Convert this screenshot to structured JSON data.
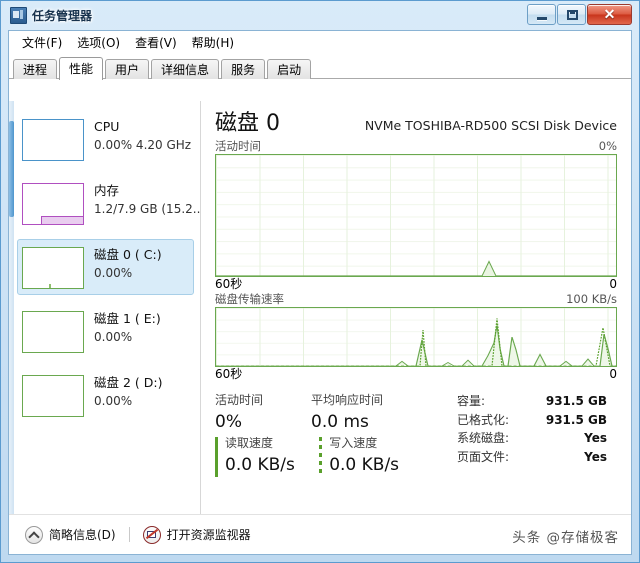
{
  "window": {
    "title": "任务管理器",
    "icon": "task-manager-icon",
    "buttons": {
      "minimize": "–",
      "maximize": "□",
      "close": "✕"
    }
  },
  "menu": [
    {
      "label": "文件(F)"
    },
    {
      "label": "选项(O)"
    },
    {
      "label": "查看(V)"
    },
    {
      "label": "帮助(H)"
    }
  ],
  "tabs": [
    {
      "label": "进程",
      "active": false
    },
    {
      "label": "性能",
      "active": true
    },
    {
      "label": "用户",
      "active": false
    },
    {
      "label": "详细信息",
      "active": false
    },
    {
      "label": "服务",
      "active": false
    },
    {
      "label": "启动",
      "active": false
    }
  ],
  "sidebar": {
    "items": [
      {
        "title": "CPU",
        "sub": "0.00%  4.20 GHz",
        "kind": "cpu",
        "selected": false
      },
      {
        "title": "内存",
        "sub": "1.2/7.9 GB (15.2...",
        "kind": "mem",
        "selected": false
      },
      {
        "title": "磁盘 0 ( C:)",
        "sub": "0.00%",
        "kind": "disk",
        "selected": true
      },
      {
        "title": "磁盘 1 ( E:)",
        "sub": "0.00%",
        "kind": "disk",
        "selected": false
      },
      {
        "title": "磁盘 2 ( D:)",
        "sub": "0.00%",
        "kind": "disk",
        "selected": false
      }
    ]
  },
  "main": {
    "title": "磁盘 0",
    "device": "NVMe TOSHIBA-RD500 SCSI Disk Device",
    "activity": {
      "label": "活动时间",
      "max": "0%",
      "x_left": "60秒",
      "x_right": "0"
    },
    "transfer": {
      "label": "磁盘传输速率",
      "max": "100 KB/s",
      "x_left": "60秒",
      "x_right": "0"
    },
    "stats_left": [
      {
        "label": "活动时间",
        "value": "0%",
        "legend": "none"
      },
      {
        "label": "平均响应时间",
        "value": "0.0 ms",
        "legend": "none"
      },
      {
        "label": "读取速度",
        "value": "0.0 KB/s",
        "legend": "solid"
      },
      {
        "label": "写入速度",
        "value": "0.0 KB/s",
        "legend": "dashed"
      }
    ],
    "stats_right": [
      {
        "label": "容量:",
        "value": "931.5 GB"
      },
      {
        "label": "已格式化:",
        "value": "931.5 GB"
      },
      {
        "label": "系统磁盘:",
        "value": "Yes"
      },
      {
        "label": "页面文件:",
        "value": "Yes"
      }
    ]
  },
  "footer": {
    "fewer_details": "简略信息(D)",
    "resource_monitor": "打开资源监视器"
  },
  "watermark": "头条 @存储极客",
  "colors": {
    "disk_green": "#6aa84f",
    "disk_fill": "#eaf5e2",
    "cpu_blue": "#4a93c9",
    "mem_purple": "#b04fc0",
    "selection_blue": "#d9ecf9"
  },
  "chart_data": [
    {
      "type": "area",
      "title": "活动时间",
      "ylabel": "",
      "xlabel": "60秒",
      "ylim": [
        0,
        100
      ],
      "ymax_label": "0%",
      "x_left_label": "60秒",
      "x_right_label": "0",
      "grid": true,
      "series": [
        {
          "name": "活动时间",
          "values": [
            0,
            0,
            0,
            0,
            0,
            0,
            0,
            0,
            0,
            0,
            0,
            0,
            0,
            0,
            0,
            0,
            0,
            0,
            0,
            0,
            0,
            0,
            0,
            0,
            0,
            0,
            0,
            0,
            0,
            0,
            0,
            0,
            0,
            0,
            0,
            0,
            0,
            0,
            0,
            0,
            0,
            4,
            8,
            4,
            0,
            0,
            0,
            0,
            0,
            0,
            0,
            0,
            0,
            0,
            0,
            0,
            0,
            0,
            0,
            0
          ]
        }
      ]
    },
    {
      "type": "line",
      "title": "磁盘传输速率",
      "ylabel": "",
      "xlabel": "60秒",
      "ylim": [
        0,
        100
      ],
      "ymax_label": "100 KB/s",
      "x_left_label": "60秒",
      "x_right_label": "0",
      "grid": true,
      "series": [
        {
          "name": "读取速度",
          "style": "solid",
          "values": [
            0,
            0,
            0,
            0,
            0,
            0,
            0,
            0,
            0,
            0,
            0,
            0,
            0,
            0,
            0,
            0,
            0,
            0,
            0,
            0,
            0,
            0,
            0,
            0,
            0,
            0,
            0,
            8,
            4,
            0,
            45,
            10,
            0,
            6,
            4,
            0,
            10,
            6,
            0,
            18,
            40,
            70,
            20,
            50,
            28,
            4,
            0,
            20,
            12,
            0,
            4,
            8,
            18,
            10,
            0,
            18,
            55,
            30,
            10,
            0
          ]
        },
        {
          "name": "写入速度",
          "style": "dashed",
          "values": [
            0,
            0,
            0,
            0,
            0,
            0,
            0,
            0,
            0,
            0,
            0,
            0,
            0,
            0,
            0,
            0,
            0,
            0,
            0,
            0,
            0,
            0,
            0,
            0,
            0,
            0,
            0,
            0,
            0,
            0,
            58,
            6,
            0,
            0,
            0,
            0,
            0,
            0,
            0,
            0,
            0,
            88,
            0,
            0,
            0,
            0,
            0,
            0,
            0,
            0,
            0,
            0,
            0,
            0,
            0,
            0,
            66,
            0,
            0,
            0
          ]
        }
      ]
    }
  ]
}
